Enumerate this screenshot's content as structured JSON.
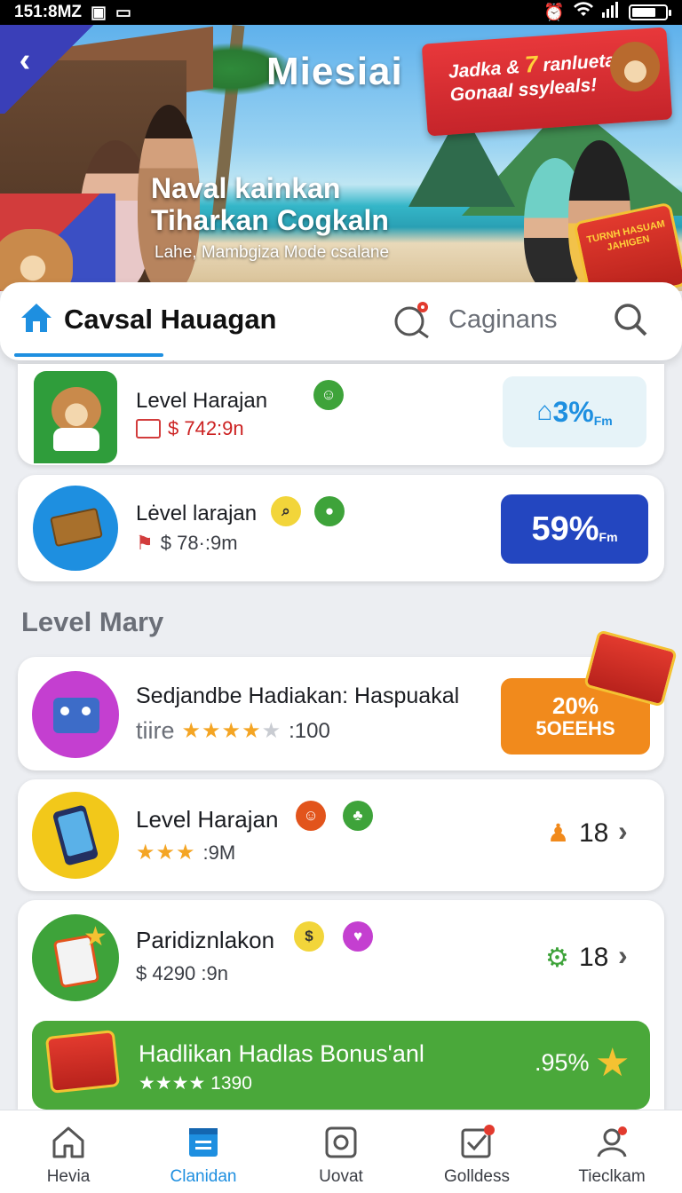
{
  "status_bar": {
    "time": "151:8MZ"
  },
  "hero": {
    "title": "Miesiai",
    "promo_line1_a": "Jadka &",
    "promo_line1_num": "7",
    "promo_line1_b": "ranlueta",
    "promo_line2": "Gonaal ssyleals!",
    "headline_line1": "Naval kainkan",
    "headline_line2": "Tiharkan Cogkaln",
    "subtitle": "Lahe, Mambgiza Mode csalane",
    "ticket_text": "TURNH HASUAM JAHIGEN"
  },
  "header": {
    "title": "Cavsal Hauagan",
    "secondary": "Caginans"
  },
  "items": [
    {
      "title": "Level Harajan",
      "price": "$ 742:9n",
      "badge": "3%",
      "badge_unit": "Fm"
    },
    {
      "title": "Lėvel larajan",
      "price": "$ 78·:9m",
      "badge": "59%",
      "badge_unit": "Fm"
    }
  ],
  "section_label": "Level Mary",
  "level_items": [
    {
      "title": "Sedjandbe Hadiakan: Haspuakal",
      "prefix": "tiire",
      "rating": 4,
      "rating_value": ":100",
      "badge_top": "20%",
      "badge_bottom": "5OEEHS"
    },
    {
      "title": "Level Harajan",
      "rating": 3,
      "rating_value": ":9M",
      "count": "18"
    },
    {
      "title": "Paridiznlakon",
      "price": "$ 4290 :9n",
      "count": "18"
    }
  ],
  "bonus": {
    "title": "Hadlikan Hadlas Bonus'anl",
    "stars": "★★★★",
    "stars_value": "1390",
    "value": ".95%"
  },
  "nav": [
    {
      "label": "Hevia",
      "icon": "home-icon"
    },
    {
      "label": "Clanidan",
      "icon": "inbox-icon"
    },
    {
      "label": "Uovat",
      "icon": "camera-icon"
    },
    {
      "label": "Golldess",
      "icon": "checkbox-icon"
    },
    {
      "label": "Tieclkam",
      "icon": "user-icon"
    }
  ],
  "colors": {
    "accent": "#1e8fe0",
    "primary_blue": "#2346c0",
    "orange": "#f18a1c",
    "green": "#3ea33a",
    "red": "#e23a2e"
  }
}
